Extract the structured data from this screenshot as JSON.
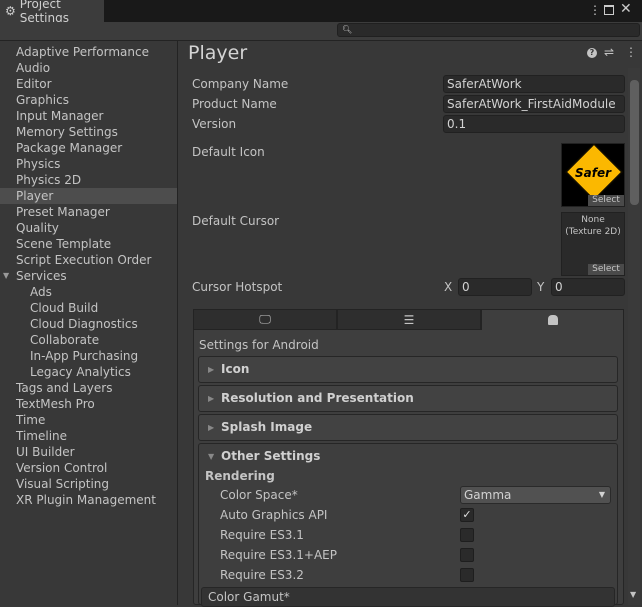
{
  "window": {
    "title": "Project Settings",
    "icons": [
      "gear-icon",
      "more-icon",
      "maximize-icon",
      "close-icon"
    ]
  },
  "search": {
    "placeholder": "",
    "icon": "search-icon"
  },
  "sidebar": {
    "items": [
      {
        "label": "Adaptive Performance"
      },
      {
        "label": "Audio"
      },
      {
        "label": "Editor"
      },
      {
        "label": "Graphics"
      },
      {
        "label": "Input Manager"
      },
      {
        "label": "Memory Settings"
      },
      {
        "label": "Package Manager"
      },
      {
        "label": "Physics"
      },
      {
        "label": "Physics 2D"
      },
      {
        "label": "Player",
        "selected": true
      },
      {
        "label": "Preset Manager"
      },
      {
        "label": "Quality"
      },
      {
        "label": "Scene Template"
      },
      {
        "label": "Script Execution Order"
      },
      {
        "label": "Services",
        "expanded": true
      },
      {
        "label": "Ads",
        "child": true
      },
      {
        "label": "Cloud Build",
        "child": true
      },
      {
        "label": "Cloud Diagnostics",
        "child": true
      },
      {
        "label": "Collaborate",
        "child": true
      },
      {
        "label": "In-App Purchasing",
        "child": true
      },
      {
        "label": "Legacy Analytics",
        "child": true
      },
      {
        "label": "Tags and Layers"
      },
      {
        "label": "TextMesh Pro"
      },
      {
        "label": "Time"
      },
      {
        "label": "Timeline"
      },
      {
        "label": "UI Builder"
      },
      {
        "label": "Version Control"
      },
      {
        "label": "Visual Scripting"
      },
      {
        "label": "XR Plugin Management"
      }
    ]
  },
  "main": {
    "title": "Player",
    "company_label": "Company Name",
    "company_value": "SaferAtWork",
    "product_label": "Product Name",
    "product_value": "SaferAtWork_FirstAidModule",
    "version_label": "Version",
    "version_value": "0.1",
    "icon_label": "Default Icon",
    "icon_image_text": "Safer",
    "select_label": "Select",
    "cursor_label": "Default Cursor",
    "cursor_value_1": "None",
    "cursor_value_2": "(Texture 2D)",
    "hotspot_label": "Cursor Hotspot",
    "x_label": "X",
    "x_value": "0",
    "y_label": "Y",
    "y_value": "0",
    "platform_tabs": [
      {
        "icon": "monitor-icon"
      },
      {
        "icon": "server-icon"
      },
      {
        "icon": "android-icon",
        "selected": true
      }
    ],
    "settings_for": "Settings for Android",
    "sections": [
      "Icon",
      "Resolution and Presentation",
      "Splash Image",
      "Other Settings"
    ],
    "rendering_label": "Rendering",
    "color_space_label": "Color Space*",
    "color_space_value": "Gamma",
    "auto_graphics_label": "Auto Graphics API",
    "auto_graphics": true,
    "es31_label": "Require ES3.1",
    "es31": false,
    "es31aep_label": "Require ES3.1+AEP",
    "es31aep": false,
    "es32_label": "Require ES3.2",
    "es32": false,
    "color_gamut_label": "Color Gamut*"
  }
}
